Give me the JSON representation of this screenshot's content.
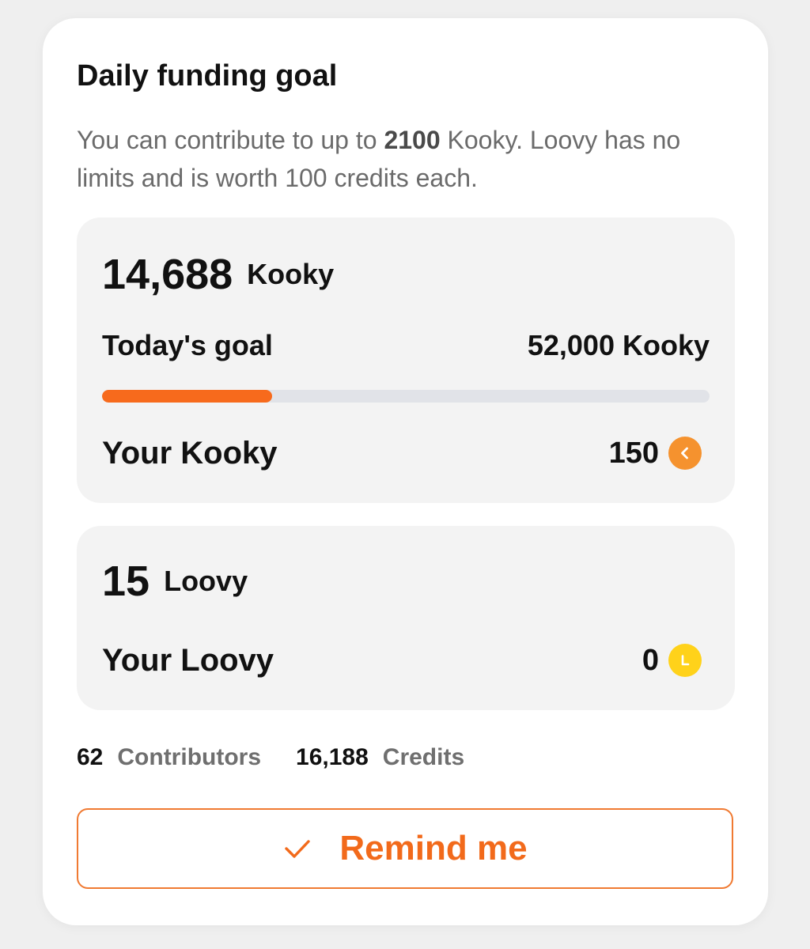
{
  "card": {
    "title": "Daily funding goal",
    "description": {
      "part1": "You can contribute to up to ",
      "limit": "2100",
      "part2": " Kooky. Loovy has no limits and is worth 100 credits each."
    }
  },
  "kooky": {
    "amount": "14,688",
    "unit": "Kooky",
    "goal_label": "Today's goal",
    "goal_value": "52,000 Kooky",
    "progress_percent": 28,
    "your_label": "Your Kooky",
    "your_value": "150",
    "coin_icon": "kooky-coin-icon",
    "coin_color": "#f5922e",
    "progress_color": "#f76a1c"
  },
  "loovy": {
    "amount": "15",
    "unit": "Loovy",
    "your_label": "Your Loovy",
    "your_value": "0",
    "coin_icon": "loovy-coin-icon",
    "coin_color": "#ffd21a"
  },
  "stats": {
    "contributors_count": "62",
    "contributors_label": "Contributors",
    "credits_count": "16,188",
    "credits_label": "Credits"
  },
  "remind_button": {
    "label": "Remind me",
    "icon": "check-icon",
    "accent_color": "#f26a1b"
  }
}
